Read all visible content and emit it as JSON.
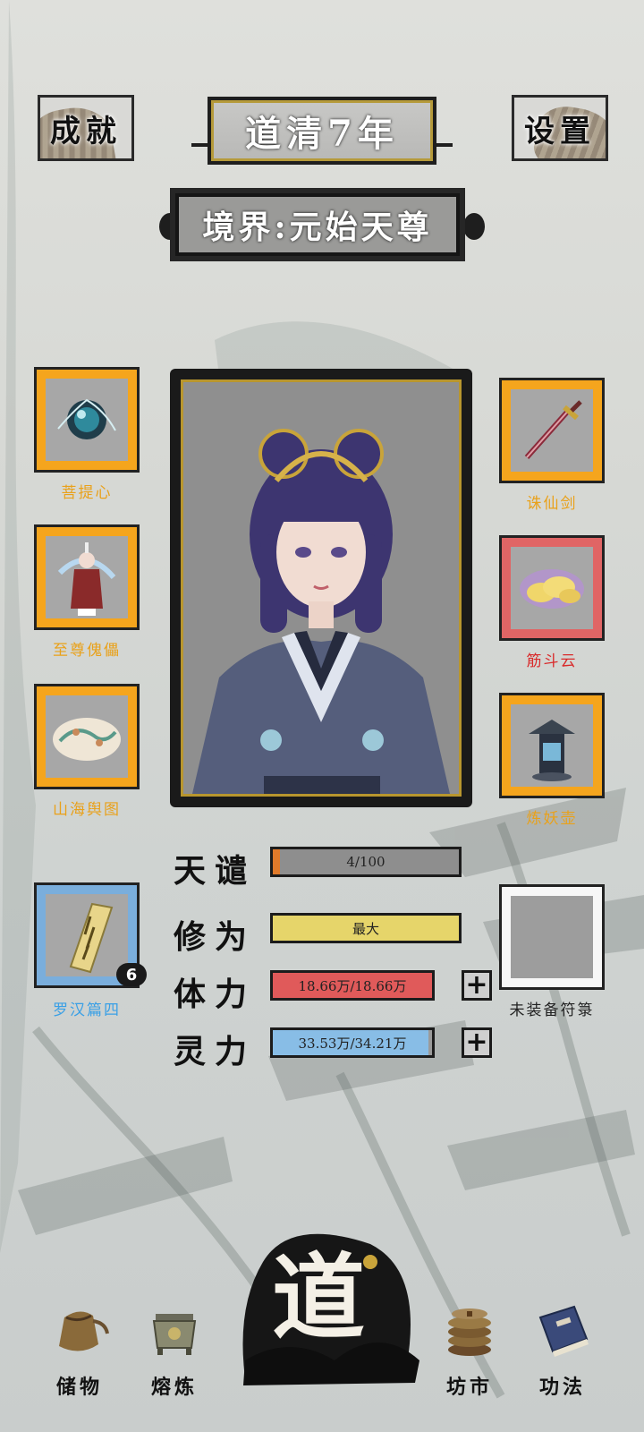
{
  "header": {
    "achievements_label": "成就",
    "year_label": "道清7年",
    "settings_label": "设置",
    "realm_label": "境界:元始天尊"
  },
  "left_slots": [
    {
      "name": "菩提心",
      "color": "gold"
    },
    {
      "name": "至尊傀儡",
      "color": "gold"
    },
    {
      "name": "山海舆图",
      "color": "gold"
    },
    {
      "name": "罗汉篇四",
      "color": "blue",
      "count": "6"
    }
  ],
  "right_slots": [
    {
      "name": "诛仙剑",
      "color": "gold"
    },
    {
      "name": "筋斗云",
      "color": "red"
    },
    {
      "name": "炼妖壶",
      "color": "gold"
    },
    {
      "name": "未装备符箓",
      "color": "white"
    }
  ],
  "stats": {
    "tianqian": {
      "label": "天谴",
      "value": "4/100",
      "fraction": 0.04,
      "color": "#e07a2a"
    },
    "xiuwei": {
      "label": "修为",
      "value": "最大",
      "fraction": 1.0,
      "color": "#e6d56a"
    },
    "tili": {
      "label": "体力",
      "value": "18.66万/18.66万",
      "fraction": 1.0,
      "color": "#e05a5a"
    },
    "lingli": {
      "label": "灵力",
      "value": "33.53万/34.21万",
      "fraction": 0.98,
      "color": "#88bde6"
    }
  },
  "nav": {
    "storage": "储物",
    "refine": "熔炼",
    "dao": "道",
    "market": "坊市",
    "skills": "功法"
  },
  "icons": {
    "plus": "+"
  }
}
